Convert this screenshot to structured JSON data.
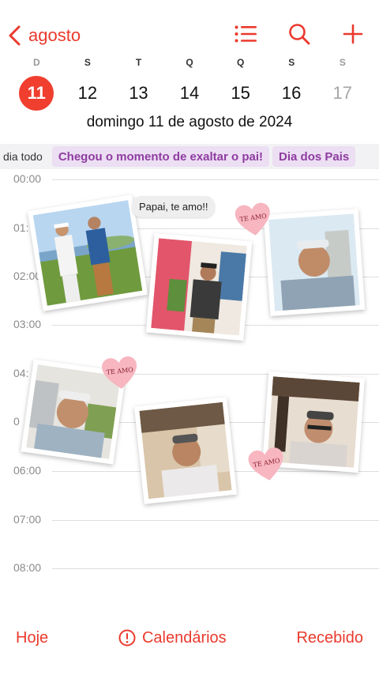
{
  "nav": {
    "back_label": "agosto",
    "icons": [
      "list-icon",
      "search-icon",
      "plus-icon"
    ]
  },
  "week": {
    "weekdays": [
      "D",
      "S",
      "T",
      "Q",
      "Q",
      "S",
      "S"
    ],
    "days": [
      "11",
      "12",
      "13",
      "14",
      "15",
      "16",
      "17"
    ],
    "selected_day": "11"
  },
  "date_title": "domingo  11 de agosto de 2024",
  "all_day": {
    "label": "dia todo",
    "events": [
      "Chegou o momento de exaltar o pai!",
      "Dia dos Pais"
    ]
  },
  "hours": [
    "00:00",
    "01:",
    "02:00",
    "03:00",
    "04:",
    "0",
    "06:00",
    "07:00",
    "08:00"
  ],
  "overlay": {
    "bubble_text": "Papai, te amo!!",
    "heart_text": "TE AMO"
  },
  "toolbar": {
    "today": "Hoje",
    "calendars": "Calendários",
    "inbox": "Recebido"
  },
  "colors": {
    "accent": "#ea3a2d",
    "event_bg": "#ecdef3",
    "event_text": "#8e3da0",
    "heart": "#f7b6c0"
  }
}
